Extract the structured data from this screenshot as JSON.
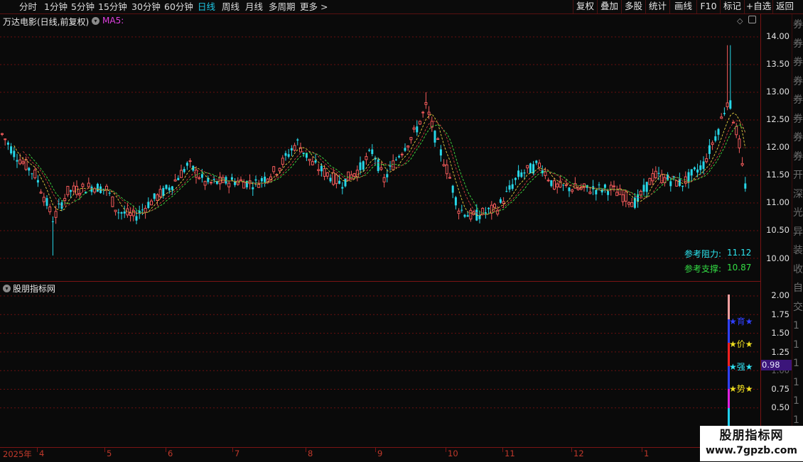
{
  "toolbar": {
    "periods": [
      "分时",
      "1分钟",
      "5分钟",
      "15分钟",
      "30分钟",
      "60分钟",
      "日线",
      "周线",
      "月线",
      "多周期",
      "更多 >"
    ],
    "active_period": "日线",
    "actions": [
      "复权",
      "叠加",
      "多股",
      "统计",
      "画线",
      "F10",
      "标记",
      "+自选",
      "返回"
    ]
  },
  "main_chart": {
    "title": "万达电影(日线,前复权)",
    "indicator": "MA5:",
    "price_labels": [
      "14.00",
      "13.50",
      "13.00",
      "12.50",
      "12.00",
      "11.50",
      "11.00",
      "10.50",
      "10.00"
    ],
    "resistance_label": "参考阻力:",
    "resistance_value": "11.12",
    "support_label": "参考支撑:",
    "support_value": "10.87"
  },
  "sub_chart": {
    "title": "股朋指标网",
    "scale_labels": [
      "2.00",
      "1.75",
      "1.50",
      "1.25",
      "1.00",
      "0.75",
      "0.50"
    ],
    "current_value": "0.98",
    "stars": [
      {
        "text": "★育★",
        "color": "#3040ff"
      },
      {
        "text": "★价★",
        "color": "#f0e020"
      },
      {
        "text": "★强★",
        "color": "#30e0f0"
      },
      {
        "text": "★势★",
        "color": "#f0e020"
      }
    ]
  },
  "date_axis": {
    "labels": [
      "2025年",
      "4",
      "5",
      "6",
      "7",
      "8",
      "9",
      "10",
      "11",
      "12",
      "1"
    ]
  },
  "right_strip": {
    "chars": [
      "券",
      "券",
      "券",
      "券",
      "券",
      "券",
      "券",
      "券",
      "开",
      "深",
      "光",
      "异",
      "装",
      "收",
      "自",
      "交",
      "1",
      "1",
      "1",
      "1",
      "1",
      "1",
      "1"
    ]
  },
  "watermark": {
    "title": "股朋指标网",
    "url": "www.7gpzb.com"
  },
  "colors": {
    "up": "#f25a5a",
    "down": "#27d7e8",
    "active": "#1ec8e6",
    "grid": "#6a0f0f",
    "resistance": "#2ee6f0",
    "support": "#33dd44"
  },
  "chart_data": {
    "type": "candlestick",
    "series": [
      {
        "name": "MA5",
        "values": []
      }
    ],
    "ylim": [
      10.0,
      14.0
    ]
  }
}
